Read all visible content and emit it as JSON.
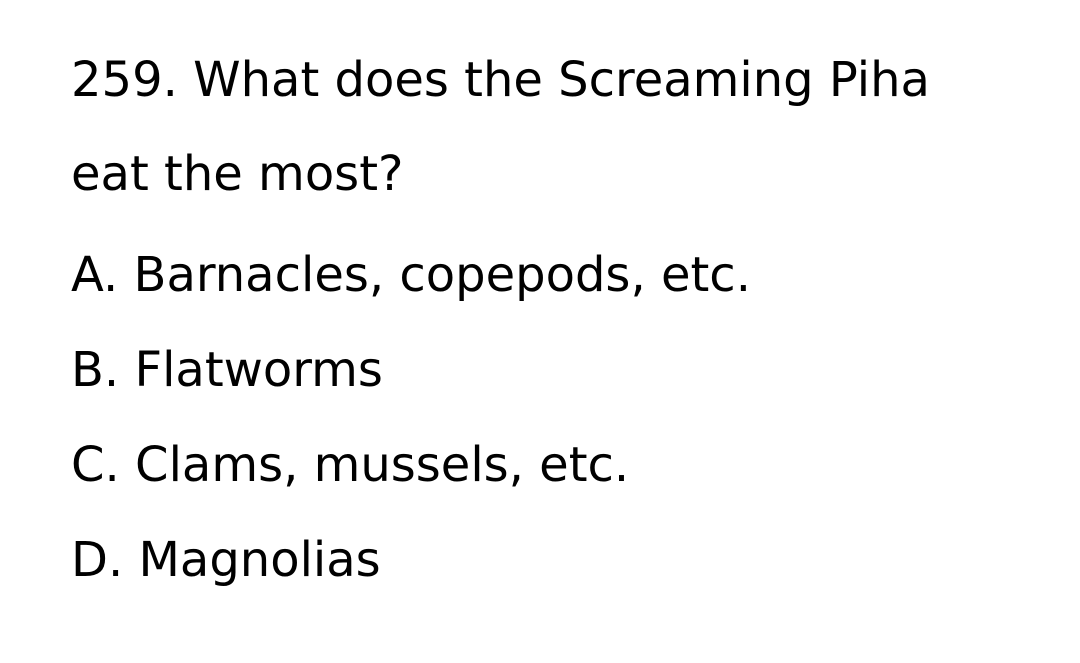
{
  "question": {
    "number": "259.",
    "line1": "What does the Screaming Piha",
    "line2": "eat the most?"
  },
  "options": [
    {
      "letter": "A.",
      "text": "Barnacles, copepods, etc."
    },
    {
      "letter": "B.",
      "text": "Flatworms"
    },
    {
      "letter": "C.",
      "text": "Clams, mussels, etc."
    },
    {
      "letter": "D.",
      "text": "Magnolias"
    }
  ]
}
